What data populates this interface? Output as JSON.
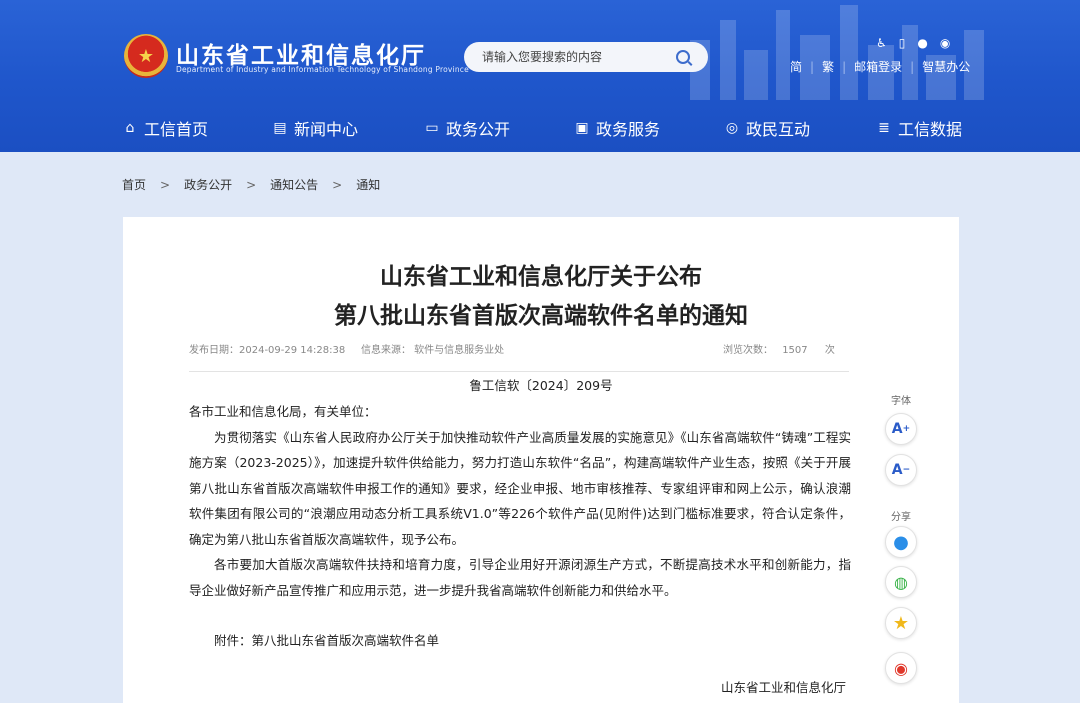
{
  "header": {
    "site_name": "山东省工业和信息化厅",
    "site_name_en": "Department of Industry and Information Technology of Shandong Province",
    "search_placeholder": "请输入您要搜索的内容",
    "top_links": [
      "简",
      "繁",
      "邮箱登录",
      "智慧办公"
    ]
  },
  "nav": [
    {
      "label": "工信首页",
      "icon": "home-icon"
    },
    {
      "label": "新闻中心",
      "icon": "news-icon"
    },
    {
      "label": "政务公开",
      "icon": "monitor-icon"
    },
    {
      "label": "政务服务",
      "icon": "service-icon"
    },
    {
      "label": "政民互动",
      "icon": "chat-icon"
    },
    {
      "label": "工信数据",
      "icon": "database-icon"
    }
  ],
  "breadcrumb": [
    "首页",
    "政务公开",
    "通知公告",
    "通知"
  ],
  "article": {
    "title_line1": "山东省工业和信息化厅关于公布",
    "title_line2": "第八批山东省首版次高端软件名单的通知",
    "publish_date": "发布日期：2024-09-29 14:28:38",
    "source": "信息来源： 软件与信息服务业处",
    "views_label": "浏览次数：",
    "views": "1507",
    "views_unit": "次",
    "doc_no": "鲁工信软〔2024〕209号",
    "salutation": "各市工业和信息化局，有关单位：",
    "para1": "为贯彻落实《山东省人民政府办公厅关于加快推动软件产业高质量发展的实施意见》《山东省高端软件“铸魂”工程实施方案（2023-2025）》，加速提升软件供给能力，努力打造山东软件“名品”，构建高端软件产业生态，按照《关于开展第八批山东省首版次高端软件申报工作的通知》要求，经企业申报、地市审核推荐、专家组评审和网上公示，确认浪潮软件集团有限公司的“浪潮应用动态分析工具系统V1.0”等226个软件产品(见附件)达到门槛标准要求，符合认定条件，确定为第八批山东省首版次高端软件，现予公布。",
    "para2": "各市要加大首版次高端软件扶持和培育力度，引导企业用好开源闭源生产方式，不断提高技术水平和创新能力，指导企业做好新产品宣传推广和应用示范，进一步提升我省高端软件创新能力和供给水平。",
    "attachment": "附件：第八批山东省首版次高端软件名单",
    "signoff": "山东省工业和信息化厅"
  },
  "side": {
    "font_label": "字体",
    "font_increase": "A",
    "font_decrease": "A",
    "share_label": "分享"
  }
}
